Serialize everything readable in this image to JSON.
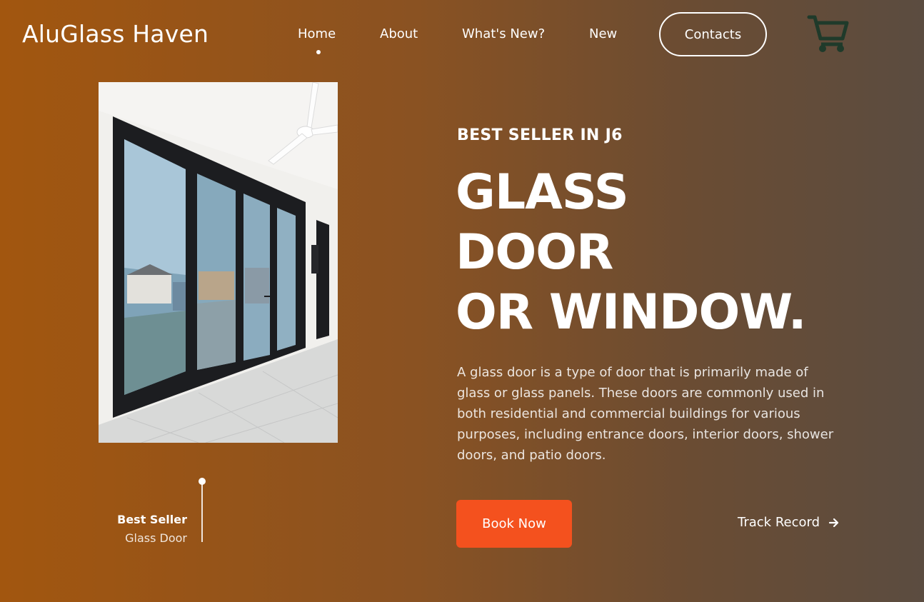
{
  "header": {
    "logo": "AluGlass Haven",
    "nav": [
      {
        "label": "Home",
        "active": true
      },
      {
        "label": "About"
      },
      {
        "label": "What's New?"
      },
      {
        "label": "New"
      }
    ],
    "contacts_label": "Contacts",
    "cart_icon": "cart-icon"
  },
  "hero": {
    "eyebrow": "BEST SELLER IN J6",
    "headline": [
      "GLASS",
      "DOOR",
      "OR WINDOW."
    ],
    "description": "A glass door is a type of door that is primarily made of glass or glass panels. These doors are commonly used in both residential and commercial buildings for various purposes, including entrance doors, interior doors, shower doors, and patio doors.",
    "book_label": "Book Now",
    "track_label": "Track Record",
    "best_seller_title": "Best Seller",
    "best_seller_sub": "Glass Door"
  },
  "colors": {
    "accent": "#f4511e",
    "cart": "#1f3a2a",
    "gradient_start": "#a2560f",
    "gradient_end": "#5b4c40"
  }
}
